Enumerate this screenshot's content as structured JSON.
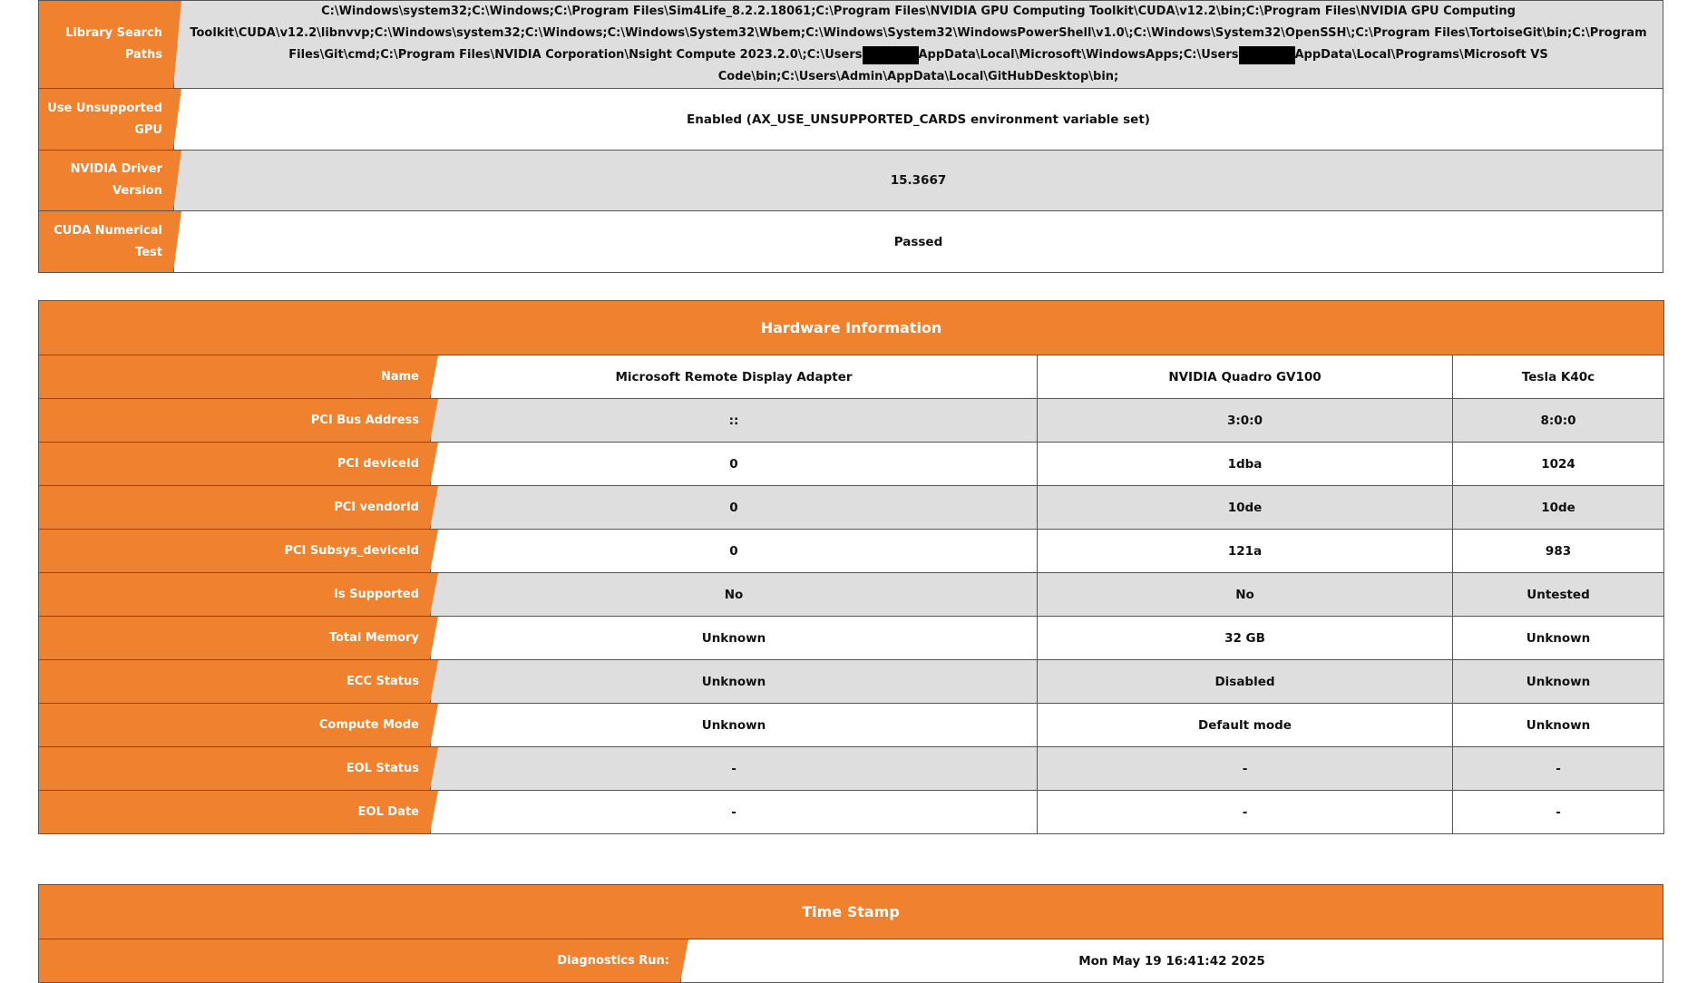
{
  "environment_rows": [
    {
      "label_lines": [
        "Library Search",
        "Paths"
      ],
      "value": ""
    },
    {
      "label_lines": [
        "Use Unsupported",
        "GPU"
      ],
      "value": "Enabled (AX_USE_UNSUPPORTED_CARDS environment variable set)"
    },
    {
      "label_lines": [
        "NVIDIA Driver",
        "Version"
      ],
      "value": "15.3667"
    },
    {
      "label_lines": [
        "CUDA Numerical",
        "Test"
      ],
      "value": "Passed"
    }
  ],
  "library_paths": {
    "part1": "C:\\Windows\\system32;C:\\Windows;C:\\Program Files\\Sim4Life_8.2.2.18061;C:\\Program Files\\NVIDIA GPU Computing Toolkit\\CUDA\\v12.2\\bin;C:\\Program Files\\NVIDIA GPU Computing Toolkit\\CUDA\\v12.2\\libnvvp;C:\\Windows\\system32;C:\\Windows;C:\\Windows\\System32\\Wbem;C:\\Windows\\System32\\WindowsPowerShell\\v1.0\\;C:\\Windows\\System32\\OpenSSH\\;C:\\Program Files\\TortoiseGit\\bin;C:\\Program Files\\Git\\cmd;C:\\Program Files\\NVIDIA Corporation\\Nsight Compute 2023.2.0\\;C:\\Users",
    "part2": "AppData\\Local\\Microsoft\\WindowsApps;C:\\Users",
    "part3": "AppData\\Local\\Programs\\Microsoft VS Code\\bin;C:\\Users\\Admin\\AppData\\Local\\GitHubDesktop\\bin;"
  },
  "hardware": {
    "title": "Hardware Information",
    "rows": [
      {
        "label": "Name",
        "values": [
          "Microsoft Remote Display Adapter",
          "NVIDIA Quadro GV100",
          "Tesla K40c"
        ]
      },
      {
        "label": "PCI Bus Address",
        "values": [
          "::",
          "3:0:0",
          "8:0:0"
        ]
      },
      {
        "label": "PCI deviceId",
        "values": [
          "0",
          "1dba",
          "1024"
        ]
      },
      {
        "label": "PCI vendorId",
        "values": [
          "0",
          "10de",
          "10de"
        ]
      },
      {
        "label": "PCI Subsys_deviceId",
        "values": [
          "0",
          "121a",
          "983"
        ]
      },
      {
        "label": "Is Supported",
        "values": [
          "No",
          "No",
          "Untested"
        ]
      },
      {
        "label": "Total Memory",
        "values": [
          "Unknown",
          "32 GB",
          "Unknown"
        ]
      },
      {
        "label": "ECC Status",
        "values": [
          "Unknown",
          "Disabled",
          "Unknown"
        ]
      },
      {
        "label": "Compute Mode",
        "values": [
          "Unknown",
          "Default mode",
          "Unknown"
        ]
      },
      {
        "label": "EOL Status",
        "values": [
          "-",
          "-",
          "-"
        ]
      },
      {
        "label": "EOL Date",
        "values": [
          "-",
          "-",
          "-"
        ]
      }
    ]
  },
  "timestamp": {
    "title": "Time Stamp",
    "label": "Diagnostics Run:",
    "value": "Mon May 19 16:41:42 2025"
  },
  "colors": {
    "accent_orange": "#f0812f",
    "row_gray": "#dedede",
    "redaction": "#000000"
  }
}
